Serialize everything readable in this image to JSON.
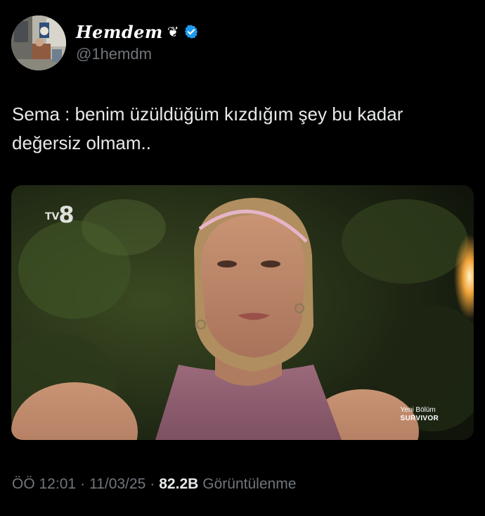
{
  "author": {
    "display_name": "Hemdem",
    "name_emoji": "❦",
    "verified_icon": "verified-badge-icon",
    "handle": "@1hemdm",
    "avatar_icon": "profile-avatar"
  },
  "tweet": {
    "text": "Sema : benim üzüldüğüm kızdığım şey bu kadar\ndeğersiz olmam.."
  },
  "media": {
    "channel_logo_prefix": "TV",
    "channel_logo_number": "8",
    "promo_line1": "Yeni Bölüm",
    "promo_line2": "SURVIVOR"
  },
  "meta": {
    "time": "ÖÖ 12:01",
    "separator": "·",
    "date": "11/03/25",
    "views_count": "82.2B",
    "views_label": "Görüntülenme"
  },
  "colors": {
    "background": "#000000",
    "text_primary": "#e7e9ea",
    "text_secondary": "#71767b",
    "verified_blue": "#1d9bf0"
  }
}
